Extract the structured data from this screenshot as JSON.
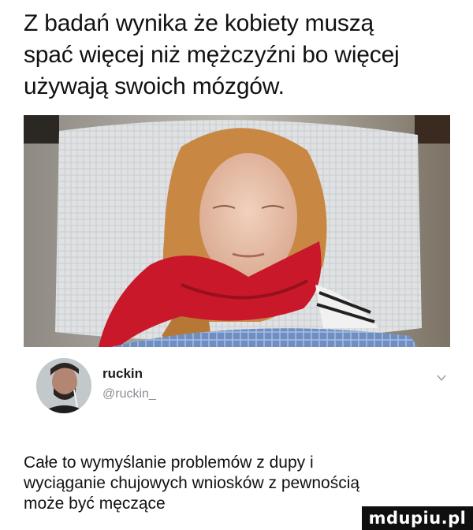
{
  "headline": {
    "line1": "Z badań wynika że kobiety muszą",
    "line2": "spać więcej niż mężczyźni bo więcej",
    "line3": "używają swoich mózgów."
  },
  "tweet": {
    "display_name": "ruckin",
    "handle": "@ruckin_",
    "text_line1": "Całe to wymyślanie problemów z dupy i",
    "text_line2": "wyciąganie chujowych wniosków z pewnością",
    "text_line3": "może być męczące"
  },
  "watermark": {
    "text": "mdupiu.pl"
  },
  "icons": {
    "menu": "chevron-down-icon",
    "avatar": "avatar"
  },
  "colors": {
    "scarf": "#c8182a",
    "hair": "#c98744",
    "pillow": "#d9dbdc",
    "handle_gray": "#8a8f94"
  }
}
